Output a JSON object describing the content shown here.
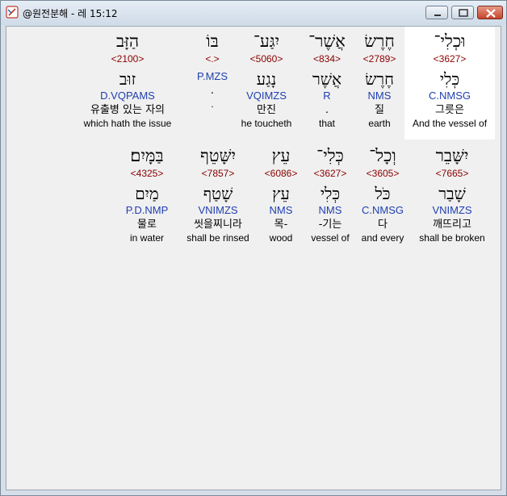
{
  "window": {
    "title": "@원전분해 - 레 15:12",
    "icon": "app-icon",
    "controls": [
      "minimize",
      "maximize",
      "close"
    ]
  },
  "rows": [
    {
      "words": [
        {
          "hebrew": "הַזָּב",
          "strong": "<2100>",
          "root": "זוּב",
          "parsing": "D.VQPAMS",
          "korean": "유출병 있는 자의",
          "english": "which hath the issue"
        },
        {
          "hebrew": "בּוֹ",
          "strong": "<.>",
          "root": "",
          "parsing": "P.MZS",
          "korean": ".",
          "english": "."
        },
        {
          "hebrew": "יִגַּע־",
          "strong": "<5060>",
          "root": "נָגַע",
          "parsing": "VQIMZS",
          "korean": "만진",
          "english": "he toucheth"
        },
        {
          "hebrew": "אֲשֶׁר־",
          "strong": "<834>",
          "root": "אֲשֶׁר",
          "parsing": "R",
          "korean": ".",
          "english": "that"
        },
        {
          "hebrew": "חֶרֶשׂ",
          "strong": "<2789>",
          "root": "חֶרֶשׂ",
          "parsing": "NMS",
          "korean": "질",
          "english": "earth"
        },
        {
          "hebrew": "וּכְלִי־",
          "strong": "<3627>",
          "root": "כְּלִי",
          "parsing": "C.NMSG",
          "korean": "그릇은",
          "english": "And the vessel of"
        }
      ]
    },
    {
      "words": [
        {
          "hebrew": "בַּמָּיִם׃",
          "strong": "<4325>",
          "root": "מַיִם",
          "parsing": "P.D.NMP",
          "korean": "물로",
          "english": "in water"
        },
        {
          "hebrew": "יִשָּׁטֵף",
          "strong": "<7857>",
          "root": "שָׁטַף",
          "parsing": "VNIMZS",
          "korean": "씻을찌니라",
          "english": "shall be rinsed"
        },
        {
          "hebrew": "עֵץ",
          "strong": "<6086>",
          "root": "עֵץ",
          "parsing": "NMS",
          "korean": "목-",
          "english": "wood"
        },
        {
          "hebrew": "כְּלִי־",
          "strong": "<3627>",
          "root": "כְּלִי",
          "parsing": "NMS",
          "korean": "-기는",
          "english": "vessel of"
        },
        {
          "hebrew": "וְכָל־",
          "strong": "<3605>",
          "root": "כֹּל",
          "parsing": "C.NMSG",
          "korean": "다",
          "english": "and every"
        },
        {
          "hebrew": "יִשָּׁבֵר",
          "strong": "<7665>",
          "root": "שָׁבַר",
          "parsing": "VNIMZS",
          "korean": "깨뜨리고",
          "english": "shall be broken"
        }
      ]
    }
  ]
}
